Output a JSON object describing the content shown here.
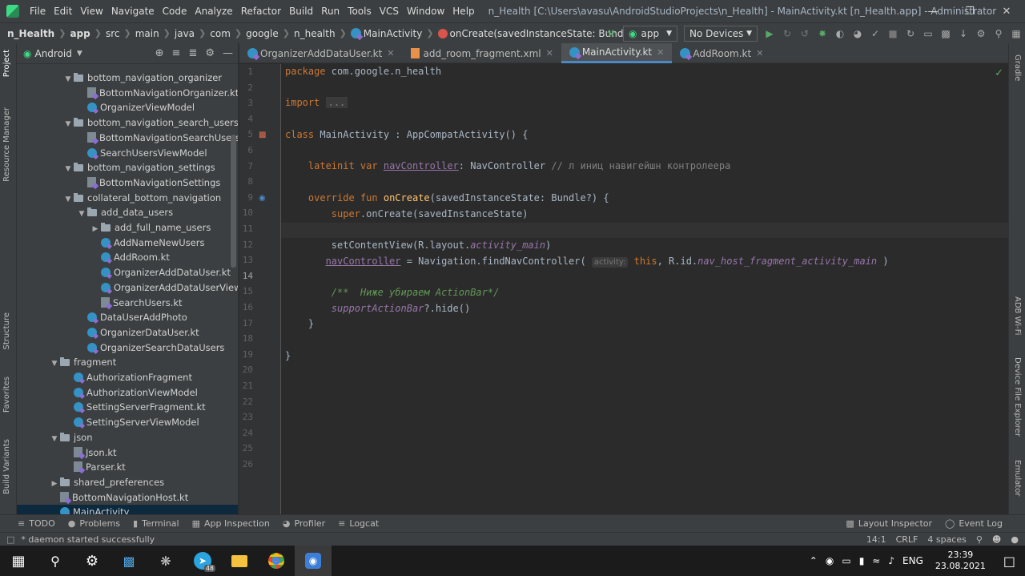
{
  "menubar": {
    "items": [
      "File",
      "Edit",
      "View",
      "Navigate",
      "Code",
      "Analyze",
      "Refactor",
      "Build",
      "Run",
      "Tools",
      "VCS",
      "Window",
      "Help"
    ],
    "title": "n_Health [C:\\Users\\avasu\\AndroidStudioProjects\\n_Health] - MainActivity.kt [n_Health.app] - Administrator"
  },
  "navbar": {
    "crumbs": [
      "n_Health",
      "app",
      "src",
      "main",
      "java",
      "com",
      "google",
      "n_health",
      "MainActivity",
      "onCreate(savedInstanceState: Bundle?)"
    ],
    "run_config": "app",
    "device": "No Devices"
  },
  "left_strip": [
    "Project",
    "Resource Manager",
    "Structure",
    "Favorites",
    "Build Variants"
  ],
  "right_strip": [
    "Gradle",
    "ADB Wi-Fi",
    "Device File Explorer",
    "Emulator"
  ],
  "project": {
    "view": "Android",
    "tree": [
      {
        "label": "bottom_navigation_organizer",
        "kind": "folder",
        "level": 4,
        "open": true
      },
      {
        "label": "BottomNavigationOrganizer.kt",
        "kind": "file",
        "level": 5
      },
      {
        "label": "OrganizerViewModel",
        "kind": "class",
        "level": 5
      },
      {
        "label": "bottom_navigation_search_users",
        "kind": "folder",
        "level": 4,
        "open": true
      },
      {
        "label": "BottomNavigationSearchUsers.",
        "kind": "file",
        "level": 5
      },
      {
        "label": "SearchUsersViewModel",
        "kind": "class",
        "level": 5
      },
      {
        "label": "bottom_navigation_settings",
        "kind": "folder",
        "level": 4,
        "open": true
      },
      {
        "label": "BottomNavigationSettings",
        "kind": "file",
        "level": 5
      },
      {
        "label": "collateral_bottom_navigation",
        "kind": "folder",
        "level": 4,
        "open": true
      },
      {
        "label": "add_data_users",
        "kind": "folder",
        "level": 5,
        "open": true
      },
      {
        "label": "add_full_name_users",
        "kind": "folder",
        "level": 6,
        "open": false
      },
      {
        "label": "AddNameNewUsers",
        "kind": "class",
        "level": 6
      },
      {
        "label": "AddRoom.kt",
        "kind": "class",
        "level": 6
      },
      {
        "label": "OrganizerAddDataUser.kt",
        "kind": "class",
        "level": 6
      },
      {
        "label": "OrganizerAddDataUserView",
        "kind": "class",
        "level": 6
      },
      {
        "label": "SearchUsers.kt",
        "kind": "file",
        "level": 6
      },
      {
        "label": "DataUserAddPhoto",
        "kind": "class",
        "level": 5
      },
      {
        "label": "OrganizerDataUser.kt",
        "kind": "class",
        "level": 5
      },
      {
        "label": "OrganizerSearchDataUsers",
        "kind": "class",
        "level": 5
      },
      {
        "label": "fragment",
        "kind": "folder",
        "level": 3,
        "open": true
      },
      {
        "label": "AuthorizationFragment",
        "kind": "class",
        "level": 4
      },
      {
        "label": "AuthorizationViewModel",
        "kind": "class",
        "level": 4
      },
      {
        "label": "SettingServerFragment.kt",
        "kind": "class",
        "level": 4
      },
      {
        "label": "SettingServerViewModel",
        "kind": "class",
        "level": 4
      },
      {
        "label": "json",
        "kind": "folder",
        "level": 3,
        "open": true
      },
      {
        "label": "Json.kt",
        "kind": "file",
        "level": 4
      },
      {
        "label": "Parser.kt",
        "kind": "file",
        "level": 4
      },
      {
        "label": "shared_preferences",
        "kind": "folder",
        "level": 3,
        "open": false
      },
      {
        "label": "BottomNavigationHost.kt",
        "kind": "file",
        "level": 3
      },
      {
        "label": "MainActivity",
        "kind": "class",
        "level": 3,
        "selected": true
      }
    ]
  },
  "tabs": [
    {
      "label": "OrganizerAddDataUser.kt",
      "kind": "kt"
    },
    {
      "label": "add_room_fragment.xml",
      "kind": "xml"
    },
    {
      "label": "MainActivity.kt",
      "kind": "kt",
      "active": true
    },
    {
      "label": "AddRoom.kt",
      "kind": "kt"
    }
  ],
  "editor": {
    "current_line": 14,
    "line_count": 26,
    "code": {
      "l1_kw": "package",
      "l1_rest": " com.google.n_health",
      "l3_kw": "import",
      "l3_fold": "...",
      "l5_kw": "class",
      "l5_rest": " MainActivity : AppCompatActivity() {",
      "l10_kw": "lateinit var",
      "l10_prop": "navController",
      "l10_rest": ": NavController ",
      "l10_cm": "// л иниц навигейшн контролеера",
      "l12_kw": "override fun",
      "l12_fn": "onCreate",
      "l12_rest": "(savedInstanceState: Bundle?) {",
      "l13_kw": "super",
      "l13_rest": ".onCreate(savedInstanceState)",
      "l15_a": "setContentView(R.layout.",
      "l15_prop": "activity_main",
      "l15_b": ")",
      "l16_prop": "navController",
      "l16_a": " = Navigation.findNavController( ",
      "l16_hint": "activity:",
      "l16_kw": "this",
      "l16_b": ", R.id.",
      "l16_prop2": "nav_host_fragment_activity_main",
      "l16_c": " )",
      "l18_doc": "/**  Ниже убираем ActionBar*/",
      "l19_prop": "supportActionBar",
      "l19_rest": "?.hide()",
      "l20": "}",
      "l22": "}"
    }
  },
  "bottom_tools": {
    "left": [
      "TODO",
      "Problems",
      "Terminal",
      "App Inspection",
      "Profiler",
      "Logcat"
    ],
    "right": [
      "Layout Inspector",
      "Event Log"
    ]
  },
  "status": {
    "message": "* daemon started successfully",
    "position": "14:1",
    "line_sep": "CRLF",
    "indent": "4 spaces"
  },
  "taskbar": {
    "lang": "ENG",
    "time": "23:39",
    "date": "23.08.2021",
    "telegram_badge": "48"
  }
}
